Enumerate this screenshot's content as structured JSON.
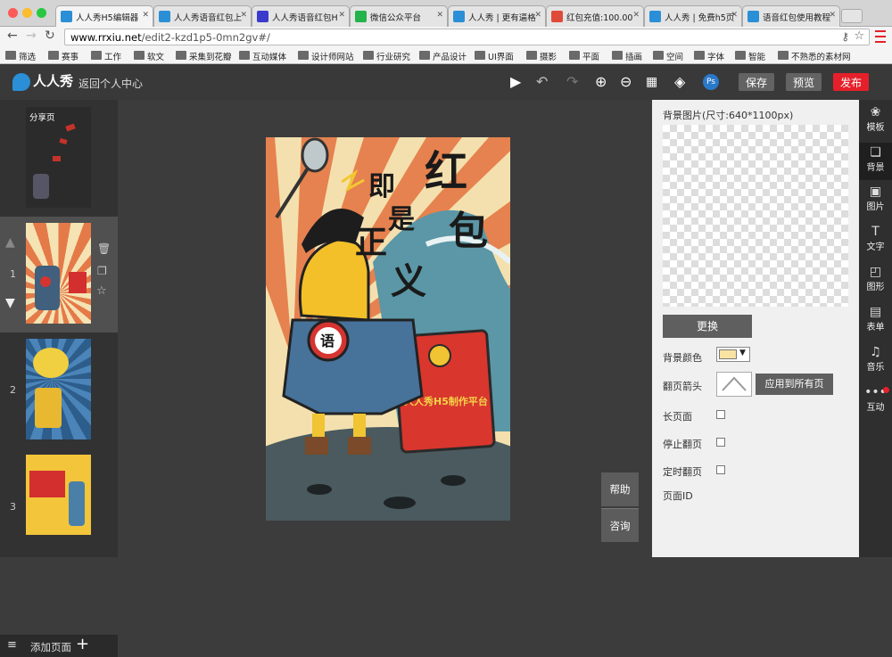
{
  "browser": {
    "tabs": [
      {
        "label": "人人秀H5编辑器",
        "color": "#2a8fd6"
      },
      {
        "label": "人人秀语音红包上",
        "color": "#2a8fd6"
      },
      {
        "label": "人人秀语音红包H",
        "color": "#3a3acc"
      },
      {
        "label": "微信公众平台",
        "color": "#23b34a"
      },
      {
        "label": "人人秀 | 更有逼格",
        "color": "#2a8fd6"
      },
      {
        "label": "红包充值:100.00",
        "color": "#e04a3a"
      },
      {
        "label": "人人秀 | 免费h5页",
        "color": "#2a8fd6"
      },
      {
        "label": "语音红包使用教程",
        "color": "#2a8fd6"
      }
    ],
    "url_host": "www.rrxiu.net",
    "url_path": "/edit2-kzd1p5-0mn2gv#/",
    "bookmarks": [
      "筛选",
      "赛事",
      "工作",
      "软文",
      "采集到花瓣",
      "互动媒体",
      "设计师网站",
      "行业研究",
      "产品设计",
      "UI界面",
      "摄影",
      "平面",
      "插画",
      "空间",
      "字体",
      "智能",
      "不熟悉的素材网"
    ]
  },
  "app": {
    "logo": "人人秀",
    "back": "返回个人中心",
    "save": "保存",
    "preview": "预览",
    "publish": "发布",
    "ps": "Ps",
    "colors": {
      "publish": "#e5202a",
      "ps": "#2a79c9",
      "brand": "#2a8fd6"
    }
  },
  "pages": {
    "share_label": "分享页",
    "nums": [
      "1",
      "2",
      "3"
    ],
    "add": "添加页面"
  },
  "help": {
    "help": "帮助",
    "consult": "咨询"
  },
  "canvas": {
    "chars": [
      "红",
      "包",
      "即",
      "是",
      "正",
      "义"
    ],
    "badge": "语",
    "brand": "人人秀H5制作平台"
  },
  "props": {
    "bg_title": "背景图片(尺寸:640*1100px)",
    "replace": "更换",
    "bg_color_label": "背景颜色",
    "bg_color": "#f9e3a3",
    "arrow_label": "翻页箭头",
    "apply_all": "应用到所有页",
    "long_page": "长页面",
    "stop_flip": "停止翻页",
    "timed_flip": "定时翻页",
    "page_id": "页面ID"
  },
  "rightbar": [
    {
      "label": "模板",
      "icon": "palette-icon"
    },
    {
      "label": "背景",
      "icon": "background-icon"
    },
    {
      "label": "图片",
      "icon": "image-icon"
    },
    {
      "label": "文字",
      "icon": "text-icon"
    },
    {
      "label": "图形",
      "icon": "shape-icon"
    },
    {
      "label": "表单",
      "icon": "form-icon"
    },
    {
      "label": "音乐",
      "icon": "music-icon"
    },
    {
      "label": "互动",
      "icon": "interact-icon"
    }
  ]
}
